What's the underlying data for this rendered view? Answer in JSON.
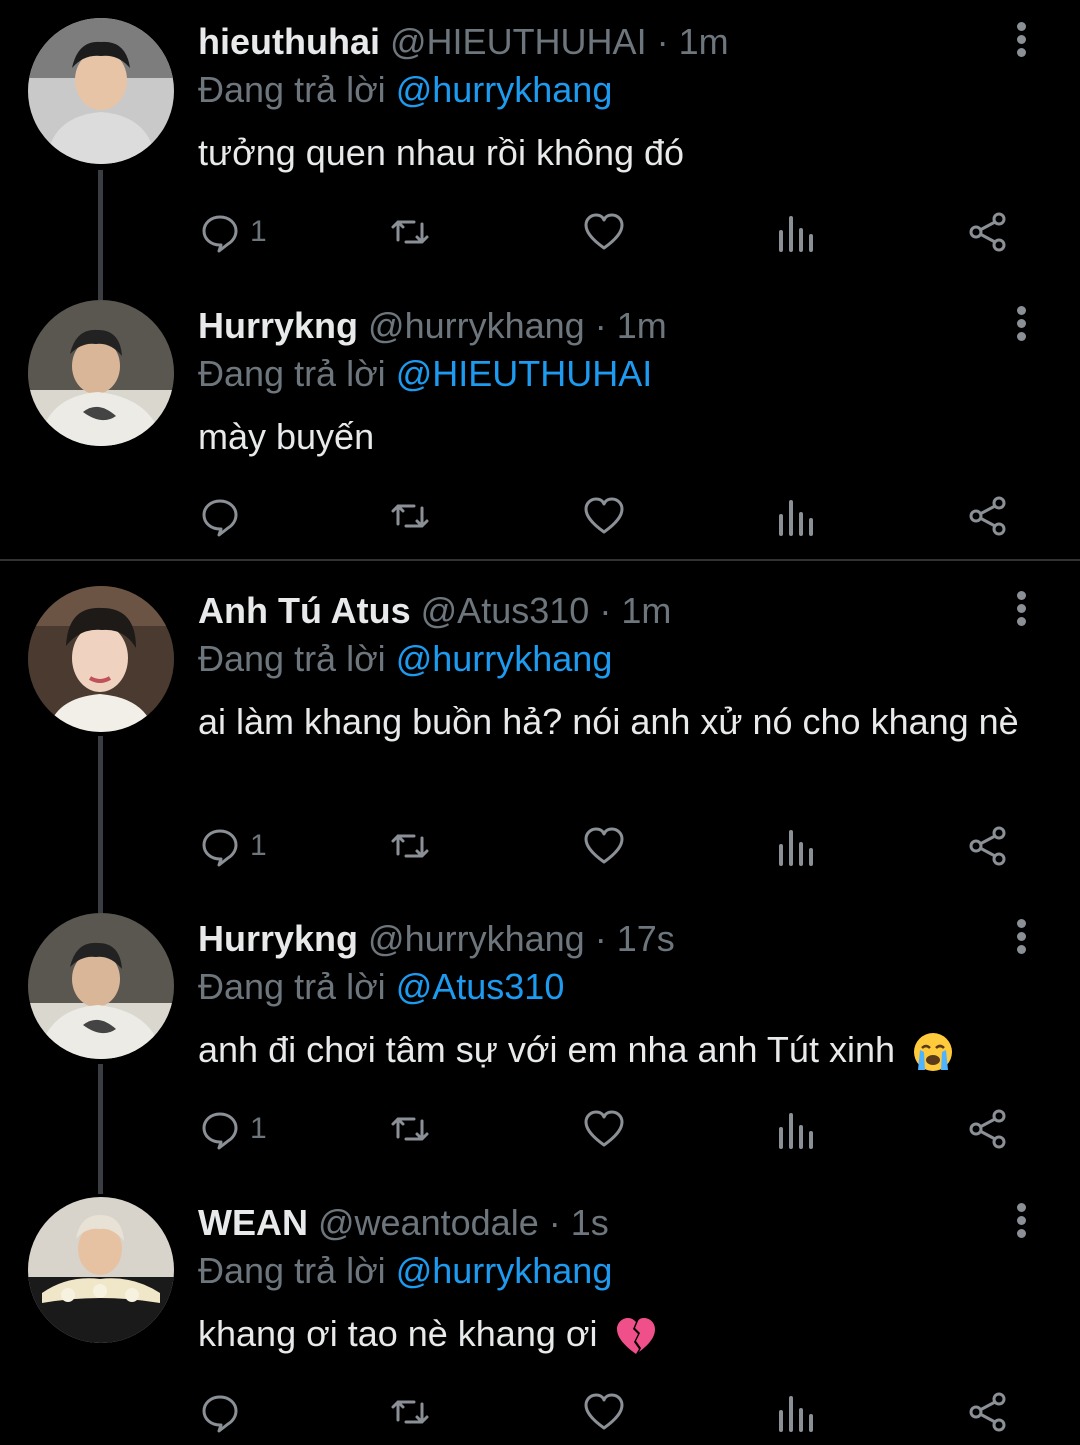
{
  "reply_prefix": "Đang trả lời",
  "tweets": [
    {
      "name": "hieuthuhai",
      "handle": "@HIEUTHUHAI",
      "dot": "·",
      "time": "1m",
      "reply_to": "@hurrykhang",
      "text": "tưởng quen nhau rồi không đó",
      "reply_count": "1"
    },
    {
      "name": "Hurrykng",
      "handle": "@hurrykhang",
      "dot": "·",
      "time": "1m",
      "reply_to": "@HIEUTHUHAI",
      "text": "mày buyến",
      "reply_count": ""
    },
    {
      "name": "Anh Tú Atus",
      "handle": "@Atus310",
      "dot": "·",
      "time": "1m",
      "reply_to": "@hurrykhang",
      "text": "ai làm khang buồn hả? nói anh xử nó cho khang nè",
      "reply_count": "1"
    },
    {
      "name": "Hurrykng",
      "handle": "@hurrykhang",
      "dot": "·",
      "time": "17s",
      "reply_to": "@Atus310",
      "text": "anh đi chơi tâm sự với em nha anh Tút xinh",
      "emoji": "loudly-crying-face",
      "reply_count": "1"
    },
    {
      "name": "WEAN",
      "handle": "@weantodale",
      "dot": "·",
      "time": "1s",
      "reply_to": "@hurrykhang",
      "text": "khang ơi tao nè khang ơi",
      "emoji": "broken-heart",
      "reply_count": ""
    }
  ],
  "colors": {
    "background": "#000000",
    "text": "#e7e9ea",
    "muted": "#6e767d",
    "mention": "#1d9bf0",
    "divider": "#2f3336"
  }
}
